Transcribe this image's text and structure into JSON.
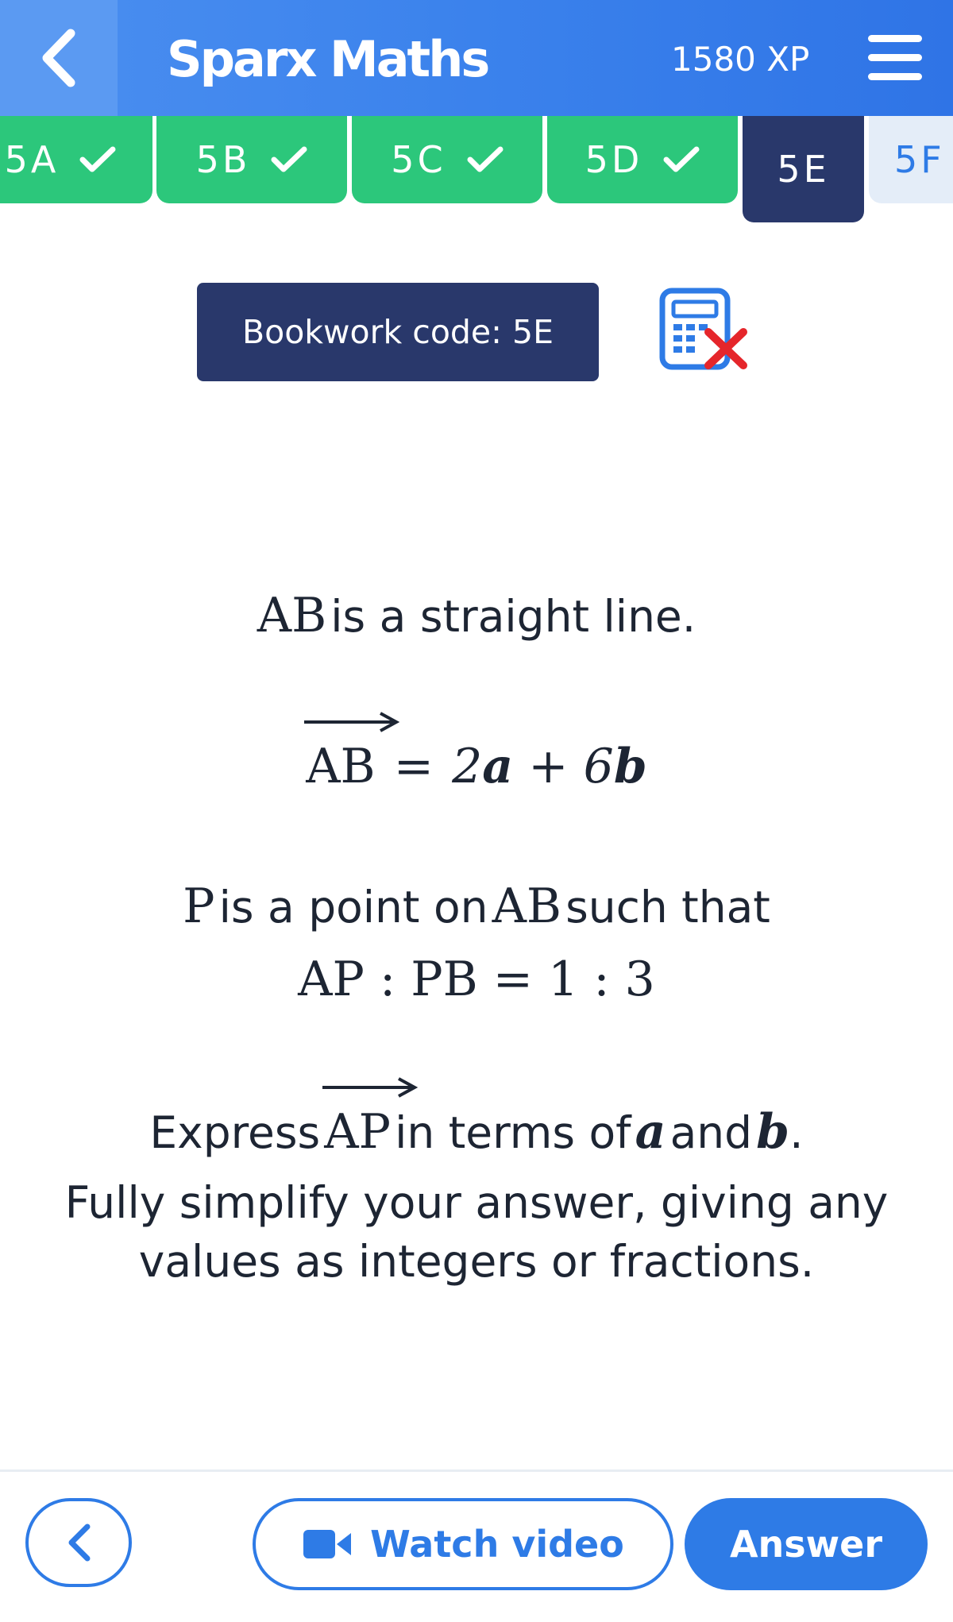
{
  "header": {
    "title": "Sparx Maths",
    "xp": "1580 XP",
    "back_icon": "chevron-left-icon",
    "menu_icon": "hamburger-menu-icon",
    "background_color": "#3b82ec"
  },
  "tabs": [
    {
      "label": "5A",
      "state": "done"
    },
    {
      "label": "5B",
      "state": "done"
    },
    {
      "label": "5C",
      "state": "done"
    },
    {
      "label": "5D",
      "state": "done"
    },
    {
      "label": "5E",
      "state": "current"
    },
    {
      "label": "5F",
      "state": "future"
    }
  ],
  "tab_colors": {
    "done": "#2cc77b",
    "current": "#29386b",
    "future": "#e4edf8"
  },
  "bookwork": {
    "label": "Bookwork code: 5E",
    "calculator_icon": "calculator-not-allowed-icon"
  },
  "question": {
    "line1_math": "AB",
    "line1_text": "is a straight line.",
    "eq_lhs": "AB",
    "eq_equals": "=",
    "eq_coef_a": "2",
    "eq_a": "a",
    "eq_plus": "+",
    "eq_coef_b": "6",
    "eq_b": "b",
    "line3_math_p": "P",
    "line3_text_a": "is a point on",
    "line3_math_ab": "AB",
    "line3_text_b": "such that",
    "ratio": "AP : PB = 1 : 3",
    "express_text": "Express",
    "express_vec": "AP",
    "express_text2": "in terms of",
    "express_a": "a",
    "express_and": "and",
    "express_b": "b",
    "express_period": ".",
    "instruction_line1": "Fully simplify your answer, giving any",
    "instruction_line2": "values as integers or fractions."
  },
  "footer": {
    "back_icon": "chevron-left-icon",
    "video_icon": "video-camera-icon",
    "watch_video_label": "Watch video",
    "answer_label": "Answer",
    "accent_color": "#2e7be6"
  }
}
